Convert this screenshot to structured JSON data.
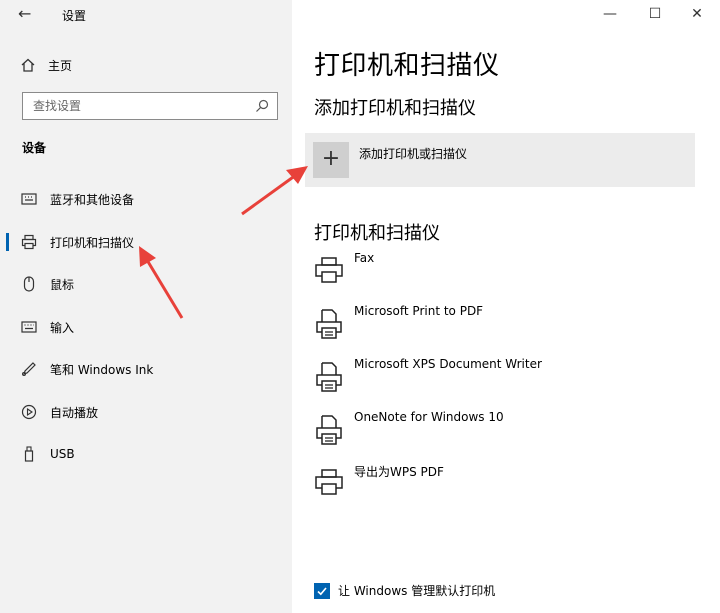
{
  "window": {
    "back": "←",
    "title": "设置",
    "minimize": "—",
    "maximize": "☐",
    "close": "✕"
  },
  "sidebar": {
    "home_label": "主页",
    "search_placeholder": "查找设置",
    "section_title": "设备",
    "items": [
      {
        "label": "蓝牙和其他设备",
        "icon": "keyboard-device-icon"
      },
      {
        "label": "打印机和扫描仪",
        "icon": "printer-icon",
        "selected": true
      },
      {
        "label": "鼠标",
        "icon": "mouse-icon"
      },
      {
        "label": "输入",
        "icon": "keyboard-icon"
      },
      {
        "label": "笔和 Windows Ink",
        "icon": "pen-icon"
      },
      {
        "label": "自动播放",
        "icon": "autoplay-icon"
      },
      {
        "label": "USB",
        "icon": "usb-icon"
      }
    ]
  },
  "main": {
    "title": "打印机和扫描仪",
    "add_section_title": "添加打印机和扫描仪",
    "add_button_label": "添加打印机或扫描仪",
    "add_button_icon": "+",
    "list_section_title": "打印机和扫描仪",
    "printers": [
      {
        "name": "Fax",
        "icon": "printer-icon"
      },
      {
        "name": "Microsoft Print to PDF",
        "icon": "document-printer-icon"
      },
      {
        "name": "Microsoft XPS Document Writer",
        "icon": "document-printer-icon"
      },
      {
        "name": "OneNote for Windows 10",
        "icon": "document-printer-icon"
      },
      {
        "name": "导出为WPS PDF",
        "icon": "printer-icon"
      }
    ],
    "default_printer_checkbox_label": "让 Windows 管理默认打印机",
    "default_printer_checked": true
  },
  "colors": {
    "accent": "#0063b1",
    "annotation_arrow": "#e8413a",
    "sidebar_bg": "#f2f2f2"
  }
}
